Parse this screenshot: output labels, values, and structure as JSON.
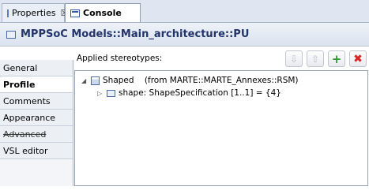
{
  "tabs": [
    {
      "label": "Properties",
      "close": "☒"
    },
    {
      "label": "Console"
    }
  ],
  "header": {
    "title": "MPPSoC Models::Main_architecture::PU"
  },
  "sidebar": {
    "items": [
      {
        "label": "General"
      },
      {
        "label": "Profile"
      },
      {
        "label": "Comments"
      },
      {
        "label": "Appearance"
      },
      {
        "label": "Advanced"
      },
      {
        "label": "VSL editor"
      }
    ]
  },
  "main": {
    "applied_label": "Applied stereotypes:",
    "toolbar": {
      "down": "⇩",
      "up": "⇧",
      "add": "+",
      "remove": "✖"
    },
    "tree": [
      {
        "expander": "◢",
        "text": "Shaped    (from MARTE::MARTE_Annexes::RSM)"
      },
      {
        "expander": "▷",
        "text": "shape: ShapeSpecification [1..1] = {4}"
      }
    ]
  }
}
